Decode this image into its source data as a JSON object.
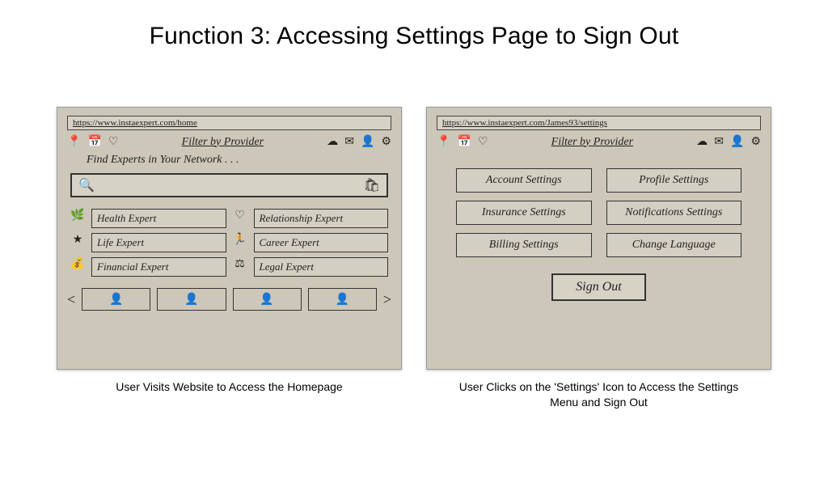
{
  "title": "Function 3: Accessing Settings Page to Sign Out",
  "panel1": {
    "url": "https://www.instaexpert.com/home",
    "filter_label": "Filter by Provider",
    "tagline": "Find Experts in Your Network . . .",
    "categories": [
      "Health Expert",
      "Relationship Expert",
      "Life Expert",
      "Career Expert",
      "Financial Expert",
      "Legal Expert"
    ],
    "caption": "User Visits Website to Access the Homepage"
  },
  "panel2": {
    "url": "https://www.instaexpert.com/James93/settings",
    "filter_label": "Filter by Provider",
    "settings": [
      "Account Settings",
      "Profile Settings",
      "Insurance Settings",
      "Notifications Settings",
      "Billing Settings",
      "Change Language"
    ],
    "signout": "Sign Out",
    "caption": "User Clicks on the 'Settings' Icon to Access the Settings Menu and Sign Out"
  }
}
